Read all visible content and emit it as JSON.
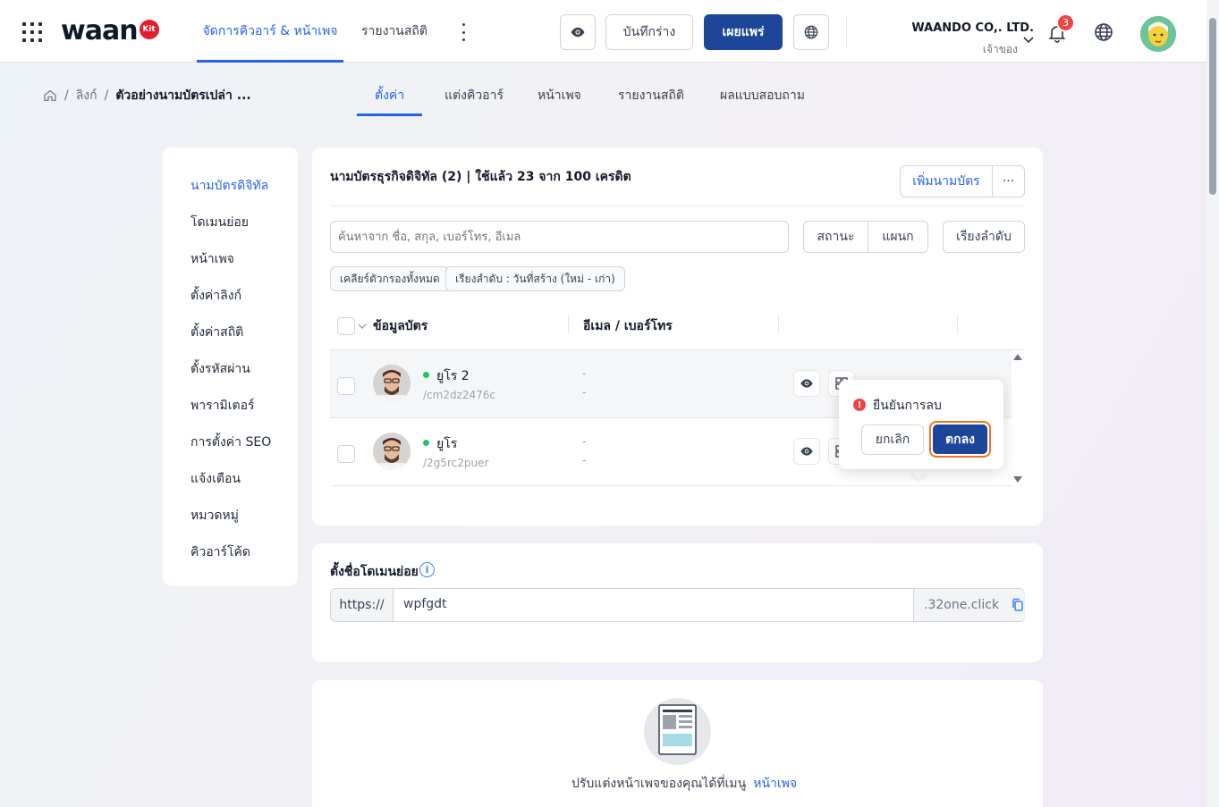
{
  "header": {
    "logo_text": "waan",
    "logo_badge": "Kit",
    "nav": [
      {
        "label": "จัดการคิวอาร์ & หน้าเพจ",
        "active": true
      },
      {
        "label": "รายงานสถิติ",
        "active": false
      }
    ],
    "save_draft_label": "บันทึกร่าง",
    "publish_label": "เผยแพร่",
    "company_name": "WAANDO CO,. LTD.",
    "company_role": "เจ้าของ",
    "notification_count": "3"
  },
  "breadcrumb": {
    "items": [
      "ลิงก์"
    ],
    "current": "ตัวอย่างนามบัตรเปล่า ..."
  },
  "subtabs": [
    {
      "label": "ตั้งค่า",
      "active": true
    },
    {
      "label": "แต่งคิวอาร์",
      "active": false
    },
    {
      "label": "หน้าเพจ",
      "active": false
    },
    {
      "label": "รายงานสถิติ",
      "active": false
    },
    {
      "label": "ผลแบบสอบถาม",
      "active": false
    }
  ],
  "sidebar": {
    "items": [
      {
        "label": "นามบัตรดิจิทัล",
        "active": true
      },
      {
        "label": "โดเมนย่อย",
        "active": false
      },
      {
        "label": "หน้าเพจ",
        "active": false
      },
      {
        "label": "ตั้งค่าลิงก์",
        "active": false
      },
      {
        "label": "ตั้งค่าสถิติ",
        "active": false
      },
      {
        "label": "ตั้งรหัสผ่าน",
        "active": false
      },
      {
        "label": "พารามิเตอร์",
        "active": false
      },
      {
        "label": "การตั้งค่า SEO",
        "active": false
      },
      {
        "label": "แจ้งเตือน",
        "active": false
      },
      {
        "label": "หมวดหมู่",
        "active": false
      },
      {
        "label": "คิวอาร์โค้ด",
        "active": false
      }
    ]
  },
  "cards_panel": {
    "title": "นามบัตรธุรกิจดิจิทัล (2) | ใช้แล้ว 23 จาก 100 เครดิต",
    "add_button": "เพิ่มนามบัตร",
    "more_label": "···",
    "search_placeholder": "ค้นหาจาก ชื่อ, สกุล, เบอร์โทร, อีเมล",
    "filter_status": "สถานะ",
    "filter_department": "แผนก",
    "sort_button": "เรียงลำดับ",
    "clear_filters": "เคลียร์ตัวกรองทั้งหมด",
    "sort_chip": "เรียงลำดับ : วันที่สร้าง (ใหม่ - เก่า)",
    "columns": [
      "ข้อมูลบัตร",
      "อีเมล / เบอร์โทร"
    ],
    "rows": [
      {
        "name": "ยูโร 2",
        "slug": "/cm2dz2476c",
        "email": "-",
        "phone": "-"
      },
      {
        "name": "ยูโร",
        "slug": "/2g5rc2puer",
        "email": "-",
        "phone": "-"
      }
    ]
  },
  "confirm_popover": {
    "title": "ยืนยันการลบ",
    "cancel_label": "ยกเลิก",
    "ok_label": "ตกลง"
  },
  "subdomain": {
    "title": "ตั้งชื่อโดเมนย่อย",
    "prefix": "https://",
    "value": "wpfgdt",
    "suffix": ".32one.click"
  },
  "page_section": {
    "text": "ปรับแต่งหน้าเพจของคุณได้ที่เมนู",
    "link": "หน้าเพจ"
  },
  "colors": {
    "accent": "#2563eb",
    "primary_button": "#1d4598",
    "danger": "#ef4444",
    "online": "#22c55e",
    "focus_ring": "#f97316"
  }
}
